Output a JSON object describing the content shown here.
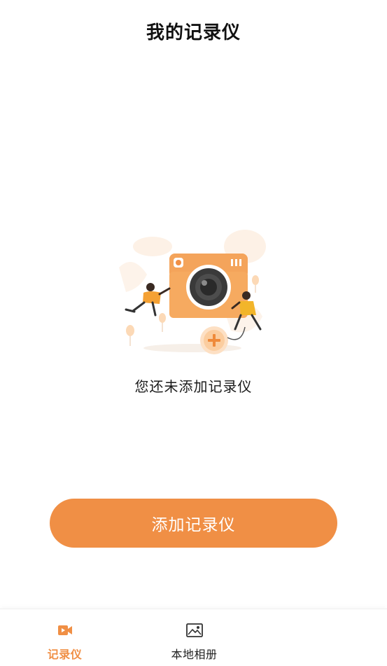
{
  "header": {
    "title": "我的记录仪"
  },
  "empty_state": {
    "illustration_icon": "camera-add-illustration",
    "message": "您还未添加记录仪"
  },
  "actions": {
    "add_button_label": "添加记录仪"
  },
  "tabbar": {
    "tabs": [
      {
        "label": "记录仪",
        "icon": "video-camera-icon",
        "active": true
      },
      {
        "label": "本地相册",
        "icon": "image-icon",
        "active": false
      }
    ]
  },
  "colors": {
    "accent": "#f08f45",
    "text_primary": "#111111",
    "background": "#ffffff"
  }
}
